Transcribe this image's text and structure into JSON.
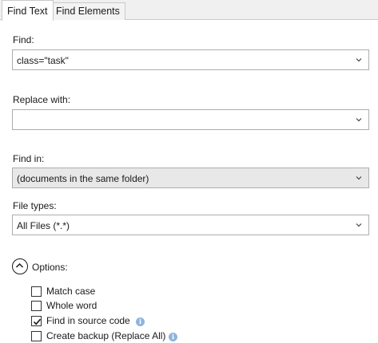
{
  "tabs": [
    {
      "label": "Find Text",
      "active": true
    },
    {
      "label": "Find Elements",
      "active": false
    }
  ],
  "find": {
    "label": "Find:",
    "value": "class=\"task\""
  },
  "replace": {
    "label": "Replace with:",
    "value": ""
  },
  "find_in": {
    "label": "Find in:",
    "value": "(documents in the same folder)"
  },
  "file_types": {
    "label": "File types:",
    "value": "All Files (*.*)"
  },
  "options": {
    "label": "Options:",
    "expanded": true,
    "items": [
      {
        "label": "Match case",
        "checked": false,
        "info": false
      },
      {
        "label": "Whole word",
        "checked": false,
        "info": false
      },
      {
        "label": "Find in source code",
        "checked": true,
        "info": true
      },
      {
        "label": "Create backup (Replace All)",
        "checked": false,
        "info": true
      }
    ]
  },
  "icons": {
    "dropdown": "chevron-down-icon",
    "options_toggle": "chevron-up-circle-icon",
    "info": "info-icon",
    "check": "checkmark-icon"
  },
  "colors": {
    "border": "#adadad",
    "disabled_bg": "#e8e8e8",
    "info": "#8fb4dc"
  }
}
